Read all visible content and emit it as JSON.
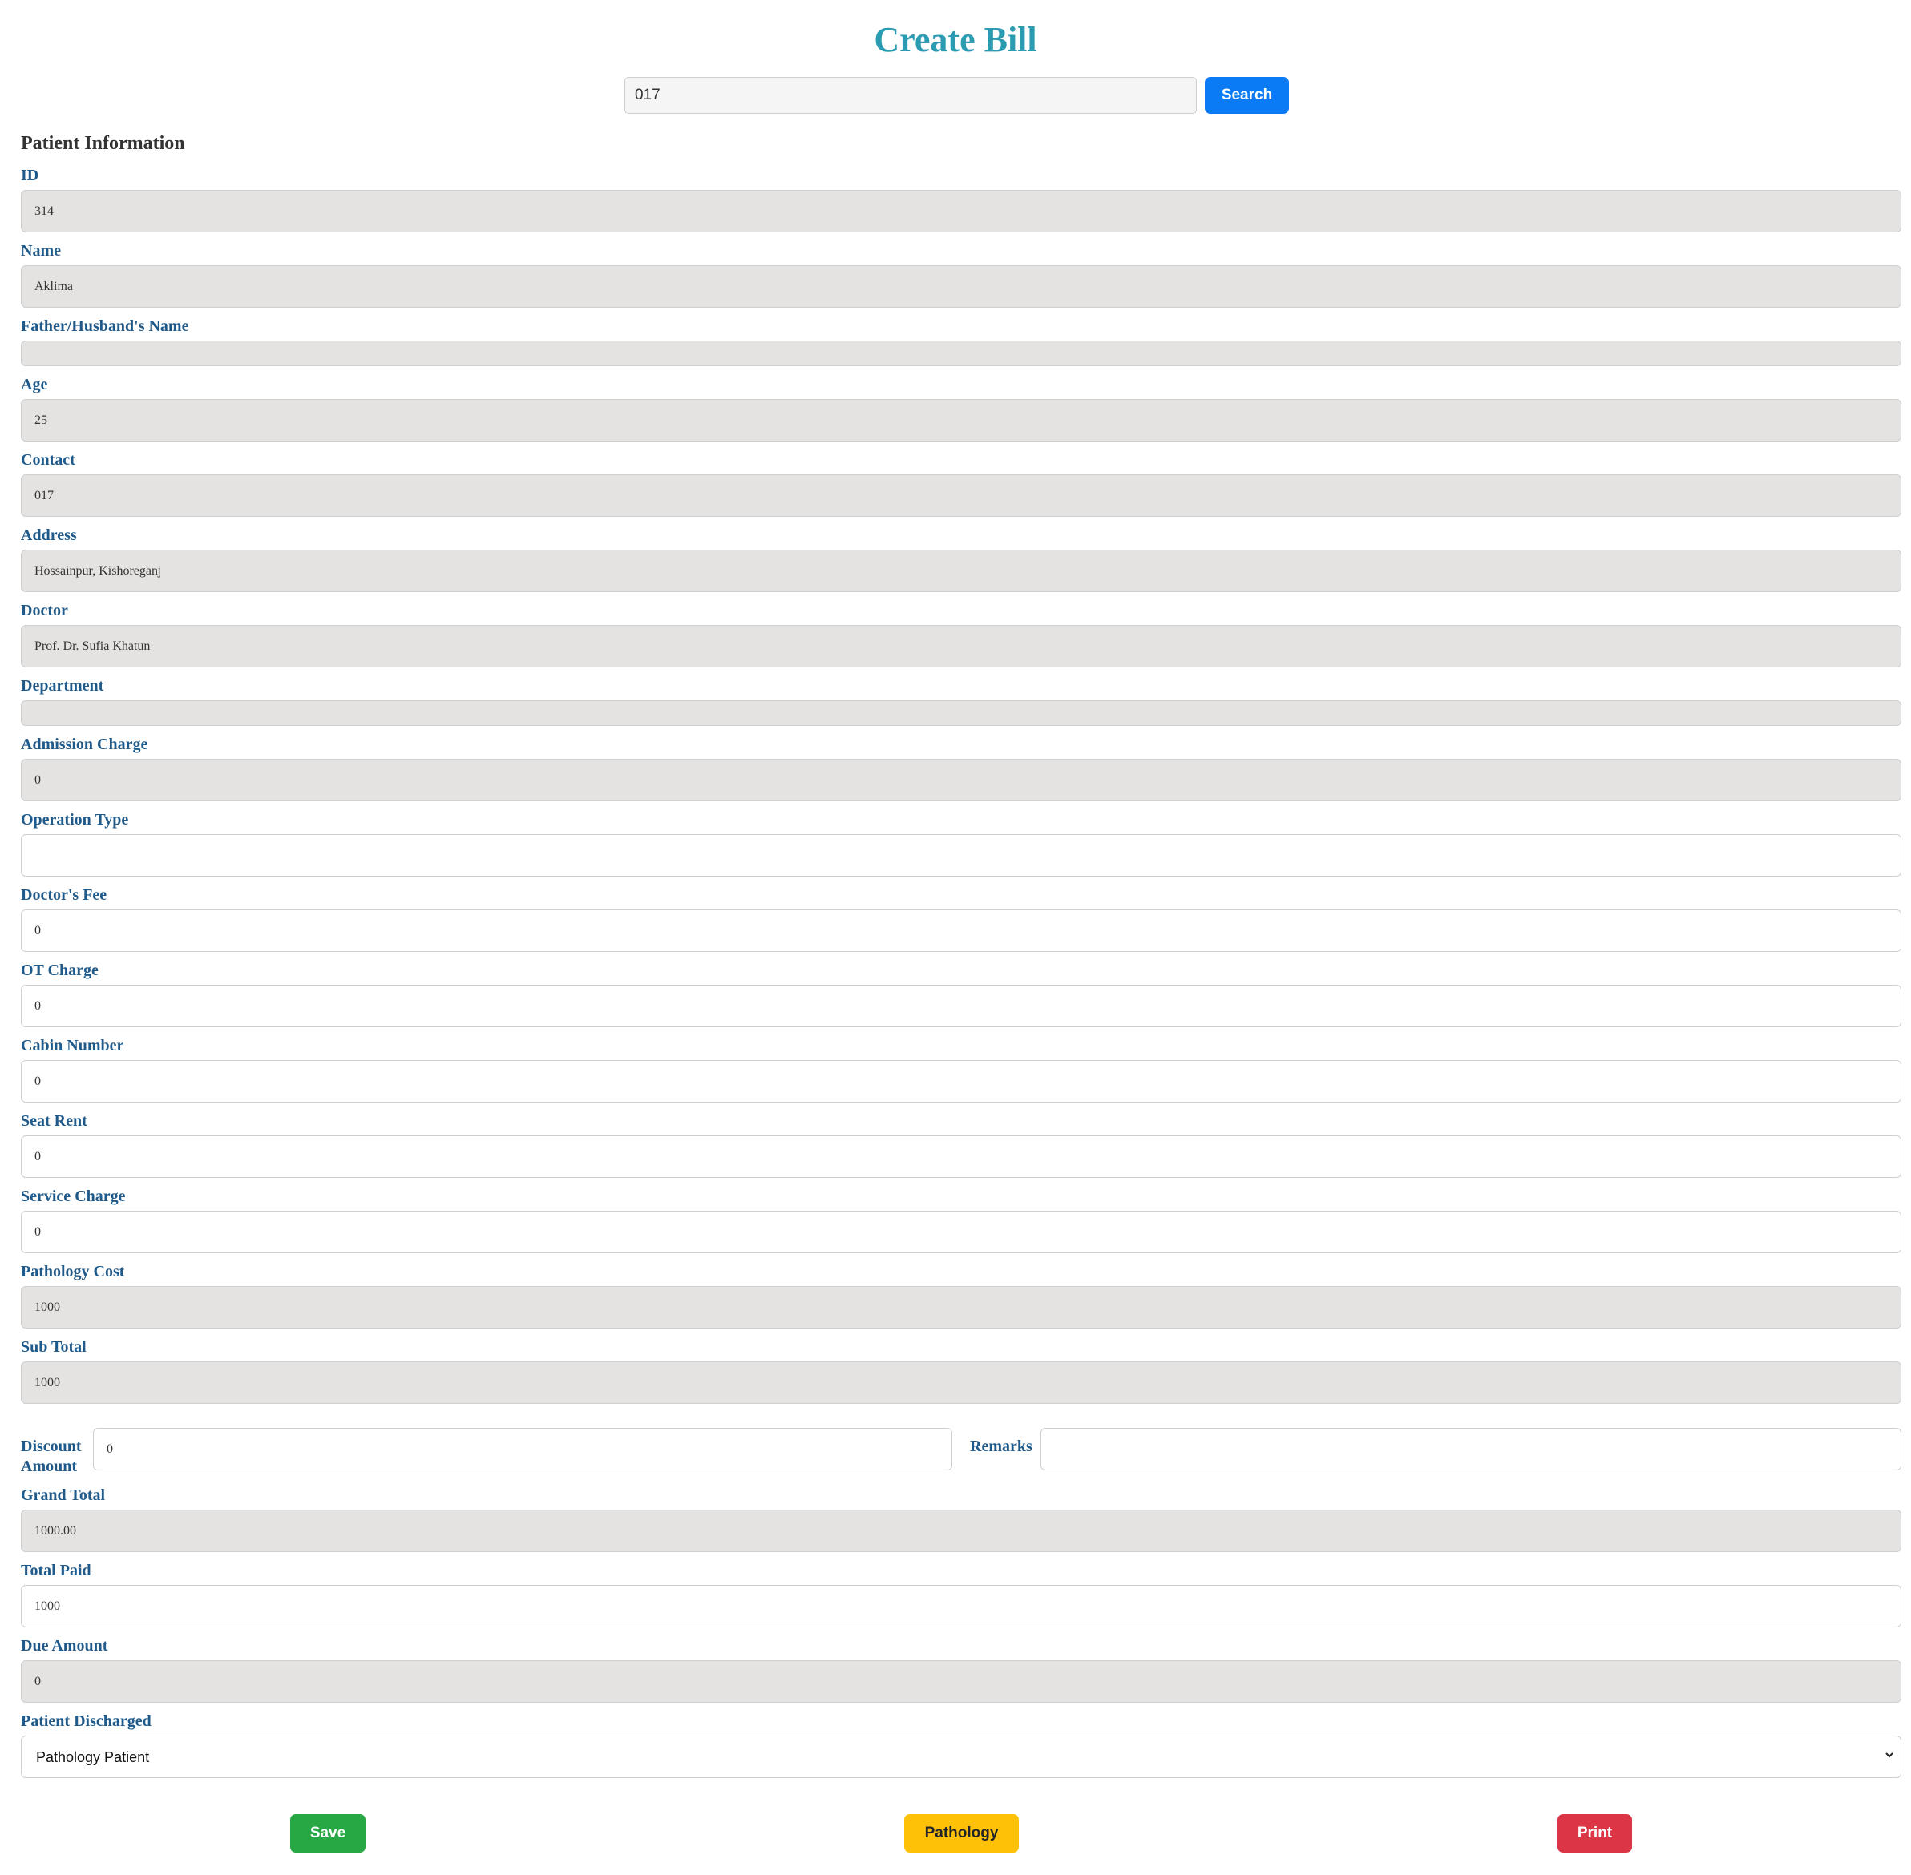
{
  "page": {
    "title": "Create Bill"
  },
  "search": {
    "value": "017",
    "button_label": "Search"
  },
  "section": {
    "heading": "Patient Information"
  },
  "fields": {
    "id": {
      "label": "ID",
      "value": "314"
    },
    "name": {
      "label": "Name",
      "value": "Aklima"
    },
    "guardian": {
      "label": "Father/Husband's Name",
      "value": ""
    },
    "age": {
      "label": "Age",
      "value": "25"
    },
    "contact": {
      "label": "Contact",
      "value": "017"
    },
    "address": {
      "label": "Address",
      "value": "Hossainpur, Kishoreganj"
    },
    "doctor": {
      "label": "Doctor",
      "value": "Prof. Dr. Sufia Khatun"
    },
    "department": {
      "label": "Department",
      "value": ""
    },
    "admission_charge": {
      "label": "Admission Charge",
      "value": "0"
    },
    "operation_type": {
      "label": "Operation Type",
      "value": ""
    },
    "doctors_fee": {
      "label": "Doctor's Fee",
      "value": "0"
    },
    "ot_charge": {
      "label": "OT Charge",
      "value": "0"
    },
    "cabin_number": {
      "label": "Cabin Number",
      "value": "0"
    },
    "seat_rent": {
      "label": "Seat Rent",
      "value": "0"
    },
    "service_charge": {
      "label": "Service Charge",
      "value": "0"
    },
    "pathology_cost": {
      "label": "Pathology Cost",
      "value": "1000"
    },
    "sub_total": {
      "label": "Sub Total",
      "value": "1000"
    },
    "discount_amount": {
      "label": "Discount Amount",
      "value": "0"
    },
    "remarks": {
      "label": "Remarks",
      "value": ""
    },
    "grand_total": {
      "label": "Grand Total",
      "value": "1000.00"
    },
    "total_paid": {
      "label": "Total Paid",
      "value": "1000"
    },
    "due_amount": {
      "label": "Due Amount",
      "value": "0"
    },
    "patient_discharged": {
      "label": "Patient Discharged",
      "selected": "Pathology Patient"
    }
  },
  "actions": {
    "save_label": "Save",
    "pathology_label": "Pathology",
    "print_label": "Print"
  },
  "colors": {
    "title": "#2a9bb0",
    "label": "#1f5a8a",
    "readonly_bg": "#e4e3e1",
    "search_button": "#0a7bf5",
    "save_button": "#28a745",
    "pathology_button": "#ffc107",
    "print_button": "#dc3545"
  }
}
